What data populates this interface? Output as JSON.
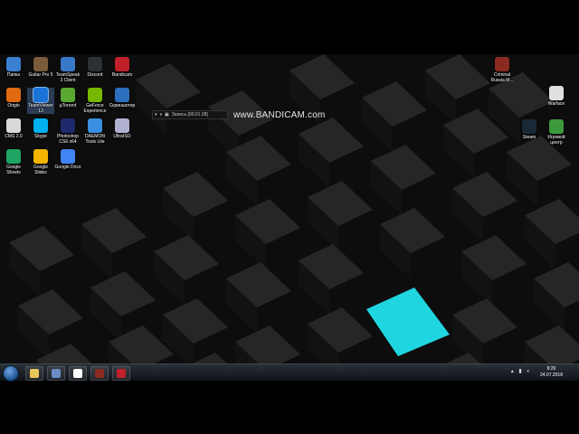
{
  "desktop_icons": [
    {
      "id": "papka",
      "label": "Папка",
      "icon": "folder-ie-icon",
      "color": "#3b7fd0",
      "col": 0,
      "row": 0
    },
    {
      "id": "guitar-pro",
      "label": "Guitar Pro 5",
      "icon": "guitar-pro-icon",
      "color": "#7a5c3a",
      "col": 1,
      "row": 0
    },
    {
      "id": "teamspeak",
      "label": "TeamSpeak 3 Client",
      "icon": "teamspeak-icon",
      "color": "#3a78c8",
      "col": 2,
      "row": 0
    },
    {
      "id": "discord",
      "label": "Discord",
      "icon": "discord-icon",
      "color": "#2c2f33",
      "col": 3,
      "row": 0
    },
    {
      "id": "bandicam",
      "label": "Bandicam",
      "icon": "bandicam-icon",
      "color": "#c0202a",
      "col": 4,
      "row": 0
    },
    {
      "id": "origin",
      "label": "Origin",
      "icon": "origin-icon",
      "color": "#e06a10",
      "col": 0,
      "row": 1
    },
    {
      "id": "teamviewer",
      "label": "TeamViewer 13",
      "icon": "teamviewer-icon",
      "color": "#1a74d8",
      "col": 1,
      "row": 1,
      "selected": true
    },
    {
      "id": "utorrent",
      "label": "µTorrent",
      "icon": "utorrent-icon",
      "color": "#5aa832",
      "col": 2,
      "row": 1
    },
    {
      "id": "geforce",
      "label": "GeForce Experience",
      "icon": "geforce-icon",
      "color": "#77b900",
      "col": 3,
      "row": 1
    },
    {
      "id": "screenshoter",
      "label": "Скриншотер",
      "icon": "screenshot-icon",
      "color": "#2d6fbf",
      "col": 4,
      "row": 1
    },
    {
      "id": "cms",
      "label": "CMS 2.0",
      "icon": "cms-icon",
      "color": "#d9d9d9",
      "col": 0,
      "row": 2
    },
    {
      "id": "skype",
      "label": "Skype",
      "icon": "skype-icon",
      "color": "#00aff0",
      "col": 1,
      "row": 2
    },
    {
      "id": "photoshop",
      "label": "Photoshop CS6 x64",
      "icon": "photoshop-icon",
      "color": "#1d2a6b",
      "col": 2,
      "row": 2
    },
    {
      "id": "daemon",
      "label": "DAEMON Tools Lite",
      "icon": "daemon-tools-icon",
      "color": "#3b8fe0",
      "col": 3,
      "row": 2
    },
    {
      "id": "ultraiso",
      "label": "UltraISO",
      "icon": "ultraiso-icon",
      "color": "#b0b0d0",
      "col": 4,
      "row": 2
    },
    {
      "id": "sheets",
      "label": "Google Sheets",
      "icon": "google-sheets-icon",
      "color": "#1fa463",
      "col": 0,
      "row": 3
    },
    {
      "id": "slides",
      "label": "Google Slides",
      "icon": "google-slides-icon",
      "color": "#f4b400",
      "col": 1,
      "row": 3
    },
    {
      "id": "docs",
      "label": "Google Docs",
      "icon": "google-docs-icon",
      "color": "#4285f4",
      "col": 2,
      "row": 3
    }
  ],
  "right_icons": [
    {
      "id": "criminal",
      "label": "Criminal Russia M...",
      "icon": "criminal-russia-icon",
      "color": "#8a2a20",
      "pos": "a"
    },
    {
      "id": "warface",
      "label": "Warface",
      "icon": "warface-icon",
      "color": "#e0e0e0",
      "pos": "b"
    },
    {
      "id": "steam",
      "label": "Steam",
      "icon": "steam-icon",
      "color": "#1b2838",
      "pos": "c"
    },
    {
      "id": "igrovoy",
      "label": "Игровой центр",
      "icon": "game-center-icon",
      "color": "#3c9a3c",
      "pos": "d"
    }
  ],
  "recording_bar": {
    "label": "Запись [00:01:28]"
  },
  "watermark": "www.BANDICAM.com",
  "taskbar": {
    "buttons": [
      {
        "id": "explorer",
        "icon": "explorer-icon",
        "color": "#e8c65a"
      },
      {
        "id": "media",
        "icon": "media-player-icon",
        "color": "#6b8dc4"
      },
      {
        "id": "yandex",
        "icon": "yandex-browser-icon",
        "color": "#ffffff"
      },
      {
        "id": "criminal-task",
        "icon": "criminal-russia-icon",
        "color": "#8a2a20"
      },
      {
        "id": "bandicam-task",
        "icon": "bandicam-icon",
        "color": "#c0202a"
      }
    ],
    "time": "8:29",
    "date": "24.07.2018"
  }
}
